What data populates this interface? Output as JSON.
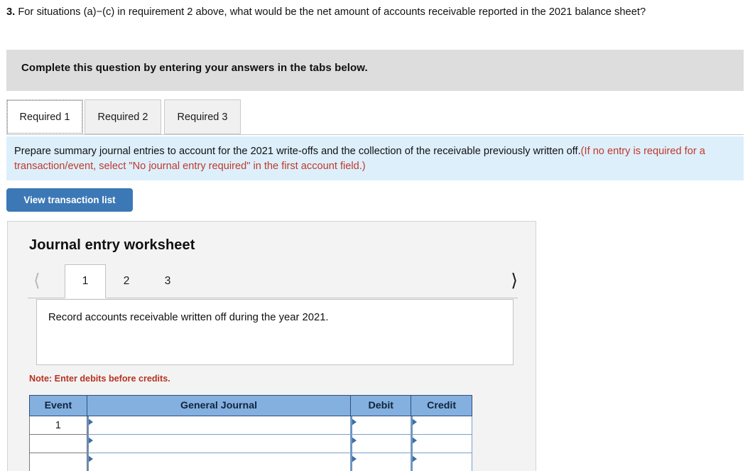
{
  "question": {
    "number": "3.",
    "text": " For situations (a)−(c) in requirement 2 above, what would be the net amount of accounts receivable reported in the 2021 balance sheet?"
  },
  "banner": {
    "text": "Complete this question by entering your answers in the tabs below."
  },
  "tabs": [
    {
      "label": "Required 1",
      "active": true
    },
    {
      "label": "Required 2",
      "active": false
    },
    {
      "label": "Required 3",
      "active": false
    }
  ],
  "instruction": {
    "black_part": "Prepare summary journal entries to account for the 2021 write-offs and the collection of the receivable previously written off.",
    "red_part": "(If no entry is required for a transaction/event, select \"No journal entry required\" in the first account field.)"
  },
  "toolbar": {
    "view_transaction_list_label": "View transaction list"
  },
  "worksheet": {
    "title": "Journal entry worksheet",
    "pager": {
      "prev_icon": "chevron-left-icon",
      "next_icon": "chevron-right-icon",
      "pages": [
        "1",
        "2",
        "3"
      ],
      "active_page": "1"
    },
    "description": "Record accounts receivable written off during the year 2021.",
    "note": "Note: Enter debits before credits.",
    "table": {
      "headers": [
        "Event",
        "General Journal",
        "Debit",
        "Credit"
      ],
      "rows": [
        {
          "event": "1",
          "general_journal": "",
          "debit": "",
          "credit": ""
        },
        {
          "event": "",
          "general_journal": "",
          "debit": "",
          "credit": ""
        },
        {
          "event": "",
          "general_journal": "",
          "debit": "",
          "credit": ""
        }
      ]
    }
  },
  "colors": {
    "banner_grey": "#dddddd",
    "info_blue": "#ddeffb",
    "button_blue": "#3c78b5",
    "table_header_blue": "#84b0e0",
    "note_red": "#b5341f",
    "instruction_red": "#c0392b"
  }
}
